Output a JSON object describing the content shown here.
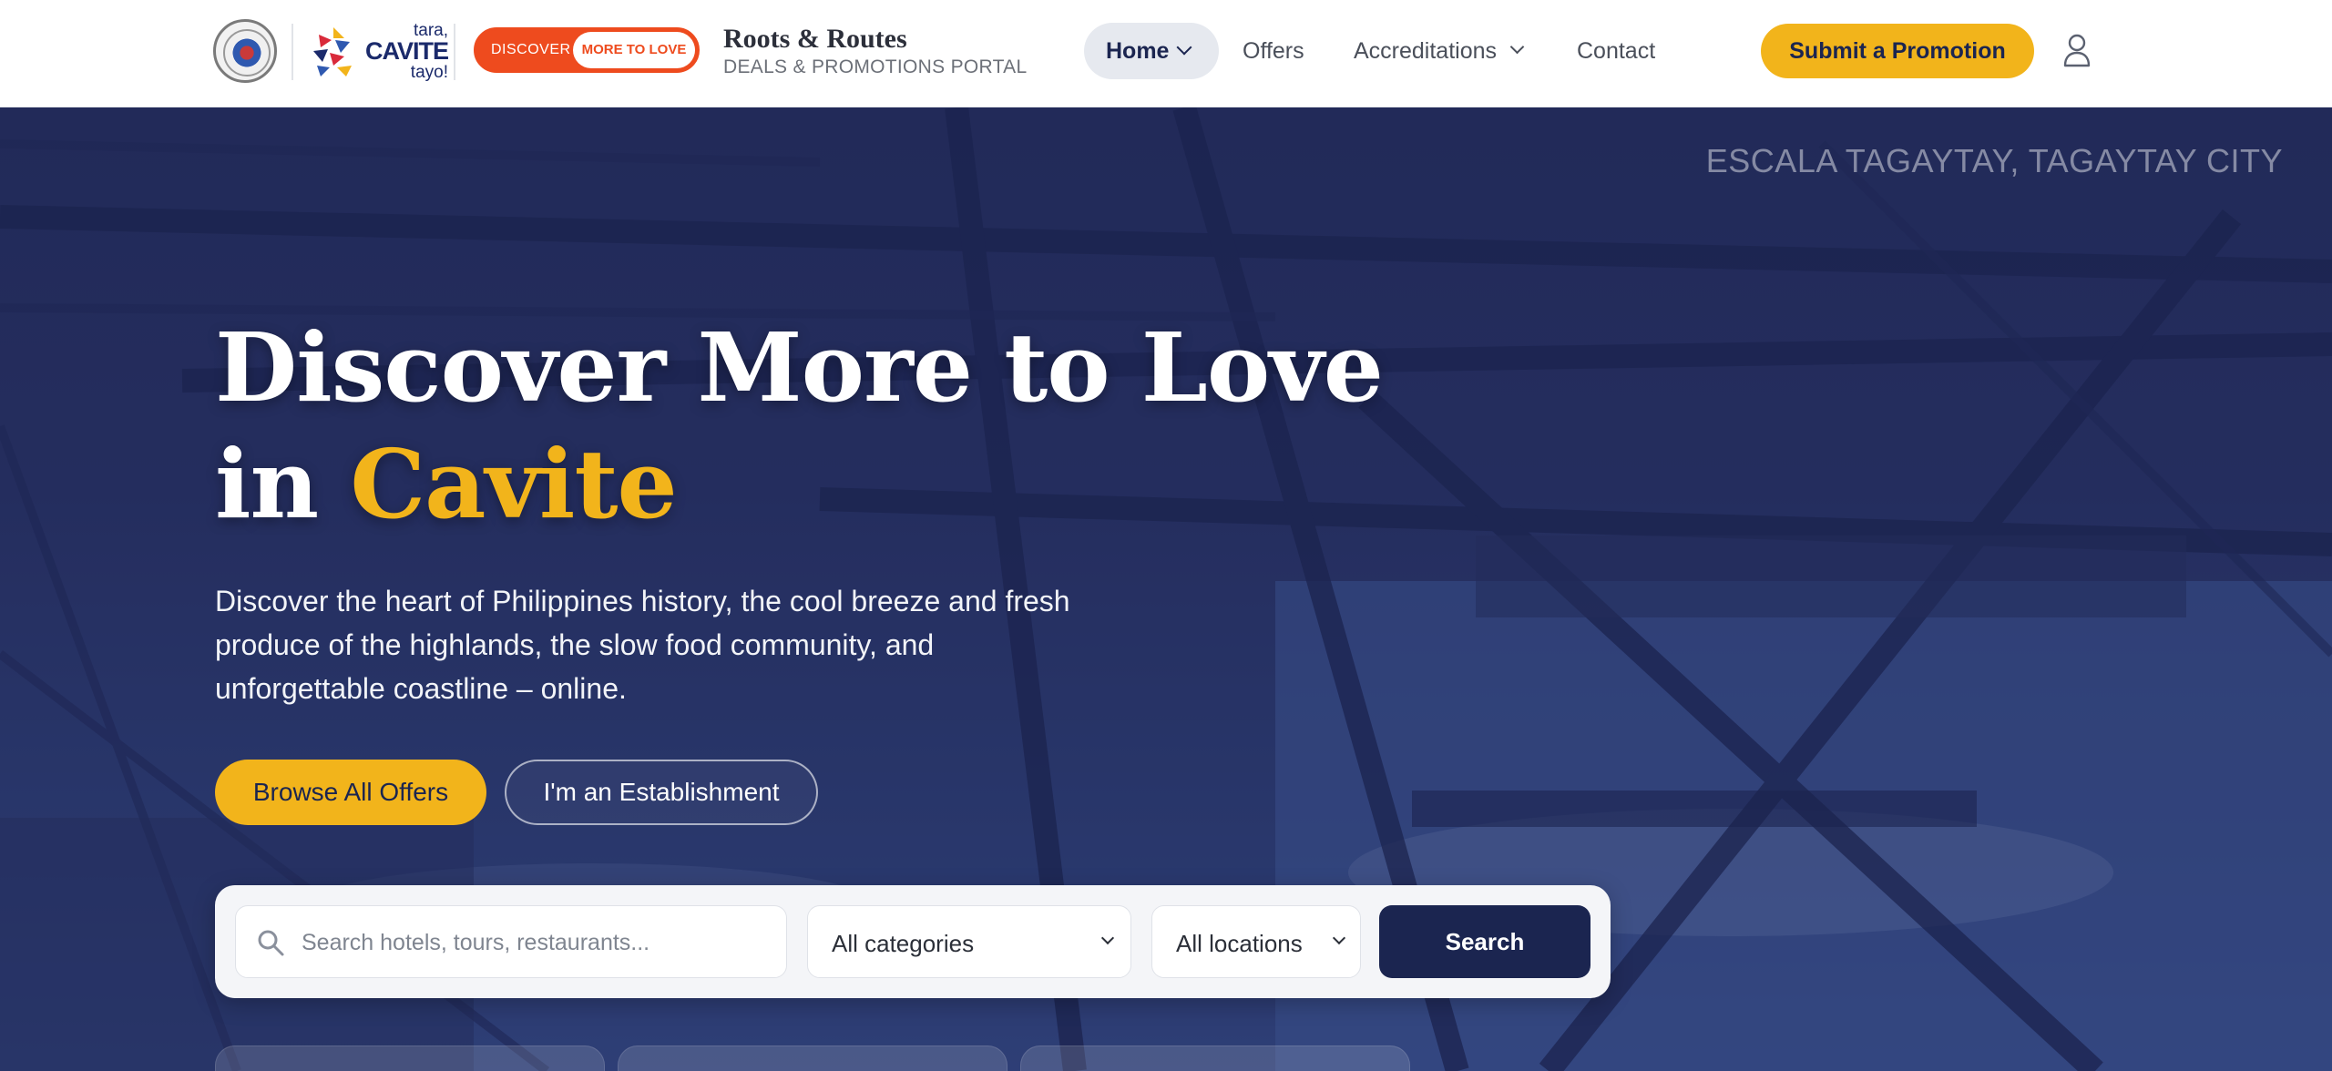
{
  "header": {
    "logo_tara": {
      "line1": "tara,",
      "line2": "CAVITE",
      "line3": "tayo!"
    },
    "discover_badge": {
      "left": "DISCOVER",
      "right": "MORE TO LOVE"
    },
    "brand_title": "Roots & Routes",
    "brand_subtitle": "DEALS & PROMOTIONS PORTAL",
    "nav": {
      "home": "Home",
      "offers": "Offers",
      "accreditations": "Accreditations",
      "contact": "Contact"
    },
    "submit_label": "Submit a Promotion"
  },
  "hero": {
    "location": "ESCALA TAGAYTAY, TAGAYTAY CITY",
    "headline_line1": "Discover More to Love",
    "headline_in": "in",
    "headline_accent": "Cavite",
    "lead": "Discover the heart of Philippines history, the cool breeze and fresh produce of the highlands, the slow food community, and unforgettable coastline – online.",
    "primary_cta": "Browse All Offers",
    "secondary_cta": "I'm an Establishment"
  },
  "search": {
    "placeholder": "Search hotels, tours, restaurants...",
    "category_value": "All categories",
    "location_value": "All locations",
    "button_label": "Search"
  },
  "colors": {
    "navy": "#1b2550",
    "gold": "#f2b41b",
    "orange": "#ee4b1e"
  },
  "icons": [
    "seal-logo",
    "tara-cavite-logo",
    "chevron-down-icon",
    "user-icon",
    "search-icon"
  ]
}
